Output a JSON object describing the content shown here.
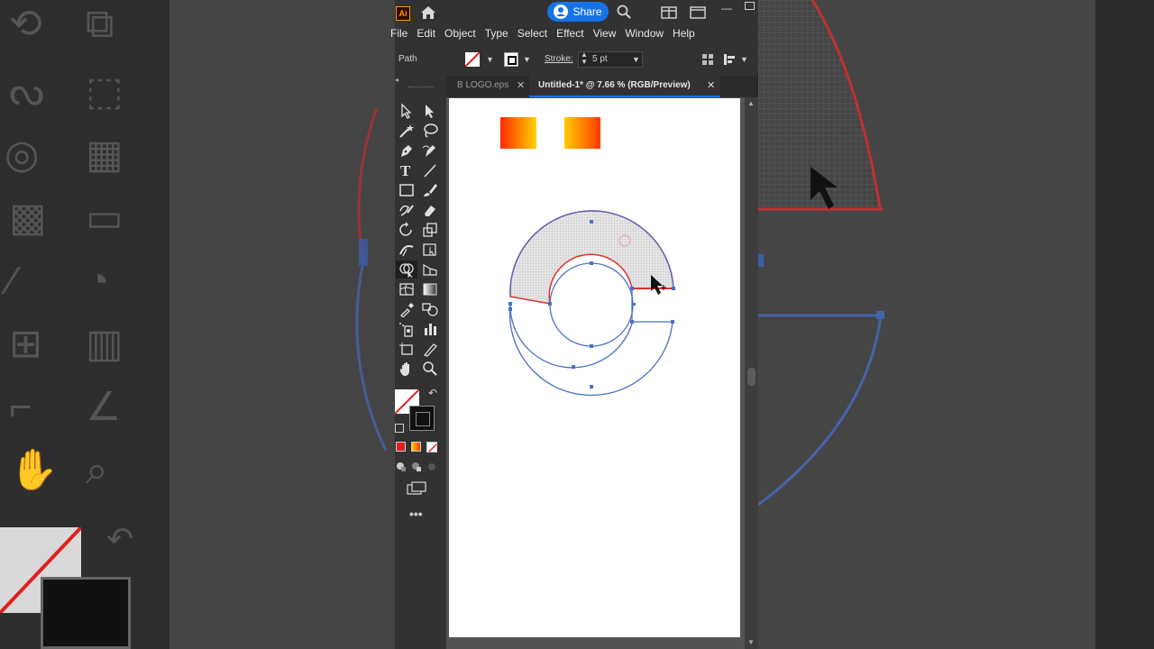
{
  "app": {
    "logo": "Ai",
    "share_label": "Share",
    "icons": [
      "home-icon",
      "search-icon",
      "arrange-documents-icon",
      "panel-layout-icon"
    ]
  },
  "menu": [
    "File",
    "Edit",
    "Object",
    "Type",
    "Select",
    "Effect",
    "View",
    "Window",
    "Help"
  ],
  "control": {
    "selection_type": "Path",
    "stroke_label": "Stroke:",
    "stroke_weight": "5 pt"
  },
  "tabs": [
    {
      "label": "B LOGO.eps",
      "active": false
    },
    {
      "label": "Untitled-1* @ 7.66 % (RGB/Preview)",
      "active": true
    }
  ],
  "colors": {
    "accent": "#1473e6",
    "path_blue": "#4a70c4",
    "selection_red": "#e03030",
    "gradient_a": [
      "#ff2a00",
      "#ffd200"
    ],
    "gradient_b": [
      "#ffcc00",
      "#ff3a00"
    ]
  }
}
